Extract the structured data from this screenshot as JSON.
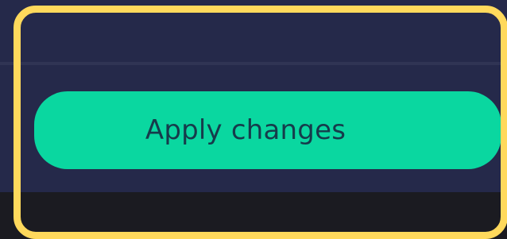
{
  "panel": {
    "primary_button_label": "Apply changes"
  },
  "colors": {
    "panel_background": "#25294A",
    "divider": "#303454",
    "footer": "#1B1B21",
    "highlight": "#FFD95C",
    "button_background": "#0AD7A0",
    "button_text": "#163B4B"
  }
}
